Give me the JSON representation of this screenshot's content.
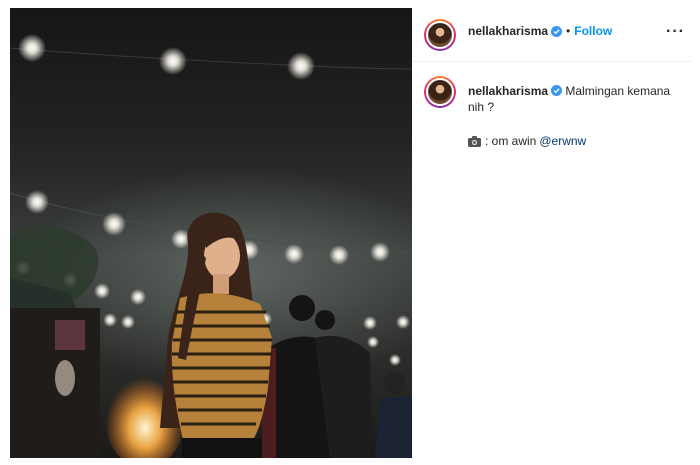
{
  "post": {
    "header": {
      "username": "nellakharisma",
      "separator": "•",
      "follow_label": "Follow",
      "more_label": "···"
    },
    "caption": {
      "username": "nellakharisma",
      "text": "Malmingan kemana nih ?",
      "credit_prefix": ": om awin",
      "credit_mention": "@erwnw"
    },
    "photo_icon": "camera-icon",
    "badge_icon": "verified-badge-icon"
  },
  "colors": {
    "follow": "#0095f6",
    "mention": "#00376b",
    "verified": "#3897f0",
    "text": "#262626",
    "divider": "#efefef"
  }
}
